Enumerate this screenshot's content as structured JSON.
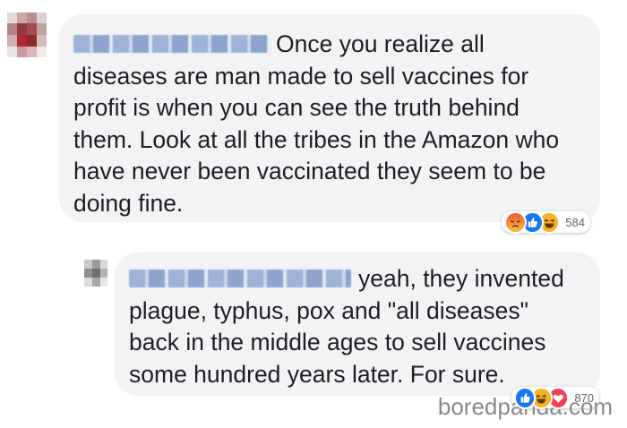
{
  "comments": [
    {
      "avatar": "blurred-avatar",
      "author_blurred": true,
      "text": "Once you realize all diseases are man made to sell vaccines for profit is when you can see the truth behind them. Look at all the tribes in the Amazon who have never been vaccinated they seem to be doing fine.",
      "reactions": [
        "angry-icon",
        "like-icon",
        "haha-icon"
      ],
      "reaction_count": "584"
    },
    {
      "avatar": "blurred-avatar",
      "author_blurred": true,
      "text": "yeah, they invented plague, typhus, pox and \"all diseases\" back in the middle ages to sell vaccines some hundred years later. For sure.",
      "reactions": [
        "like-icon",
        "haha-icon",
        "love-icon"
      ],
      "reaction_count": "870"
    }
  ],
  "watermark": "boredpanda.com",
  "colors": {
    "bubble": "#f2f3f5",
    "text": "#1c1e21",
    "count": "#606770",
    "like": "#1877f2",
    "love": "#f33e58",
    "angry": "#e9710f",
    "haha": "#f7b125"
  }
}
